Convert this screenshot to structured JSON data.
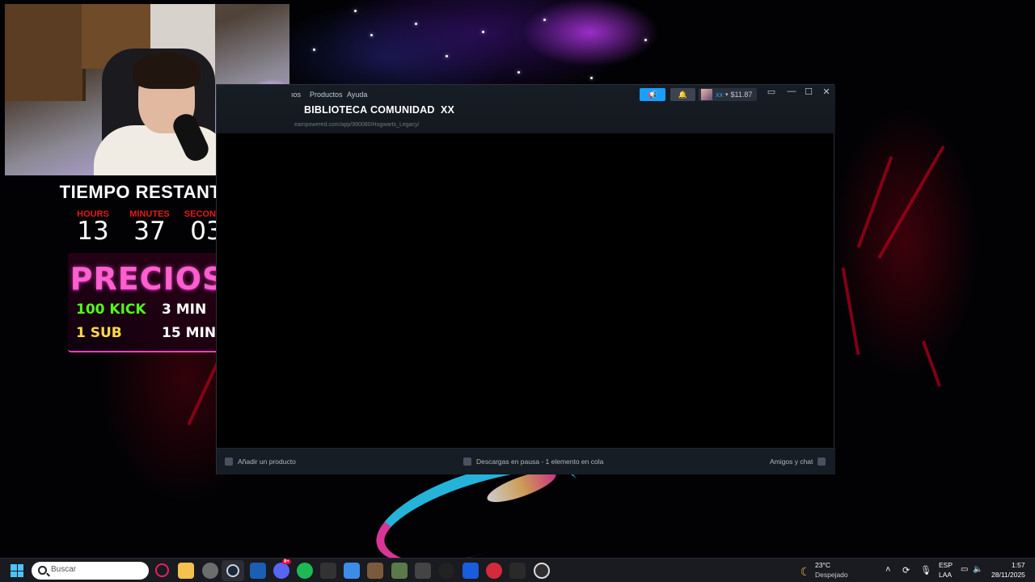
{
  "overlay": {
    "title": "TIEMPO RESTANTE:",
    "timer": [
      {
        "label": "HOURS",
        "value": "13"
      },
      {
        "label": "MINUTES",
        "value": "37"
      },
      {
        "label": "SECONDS",
        "value": "03"
      }
    ],
    "prices_title": "PRECIOS",
    "prices": [
      {
        "item": "100 KICK",
        "time": "3 MIN"
      },
      {
        "item": "1 SUB",
        "time": "15 MIN"
      }
    ]
  },
  "steam": {
    "menu": [
      "ıos",
      "Productos",
      "Ayuda"
    ],
    "nav": [
      "BIBLIOTECA",
      "COMUNIDAD",
      "XX"
    ],
    "url": "eampowered.com/app/990080/Hogwarts_Legacy/",
    "account_name": "xx",
    "wallet": "$11.87",
    "footer": {
      "add_product": "Añadir un producto",
      "downloads": "Descargas en pausa - 1 elemento en cola",
      "friends": "Amigos y chat"
    }
  },
  "taskbar": {
    "search_placeholder": "Buscar",
    "weather_temp": "23°C",
    "weather_desc": "Despejado",
    "lang_top": "ESP",
    "lang_bottom": "LAA",
    "time": "1:57",
    "date": "28/11/2025",
    "apps": [
      "opera-gx-icon",
      "file-explorer-icon",
      "chrome-icon",
      "steam-icon",
      "shield-app-icon",
      "discord-icon",
      "spotify-icon",
      "bm-app-icon",
      "notepad-icon",
      "game-icon",
      "game2-icon",
      "car-icon",
      "logitech-icon",
      "bitwarden-icon",
      "red-app-icon",
      "epic-icon",
      "obs-icon"
    ],
    "discord_badge": "9+"
  },
  "colors": {
    "accent_blue": "#1a9fff",
    "timer_label_red": "#e31a1a",
    "kick_green": "#53fc18",
    "sub_yellow": "#ffd84a",
    "precios_pink": "#ff5fcf"
  }
}
